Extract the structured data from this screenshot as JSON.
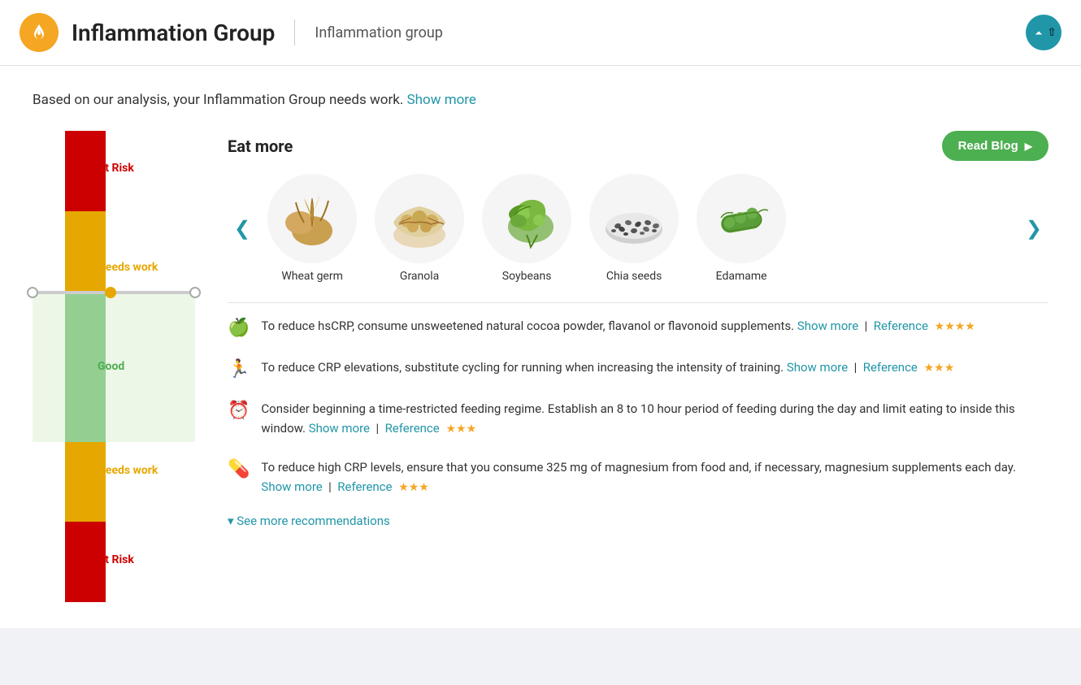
{
  "header": {
    "app_name": "Inflammation Group",
    "subtitle": "Inflammation group",
    "up_button_label": "Up"
  },
  "analysis": {
    "text_before": "Based on our analysis, your Inflammation Group needs work.",
    "show_more_label": "Show more"
  },
  "eat_more": {
    "title": "Eat more",
    "read_blog_label": "Read Blog",
    "foods": [
      {
        "name": "Wheat germ",
        "color": "#c8a870"
      },
      {
        "name": "Granola",
        "color": "#d4a055"
      },
      {
        "name": "Soybeans",
        "color": "#7aab3a"
      },
      {
        "name": "Chia seeds",
        "color": "#888"
      },
      {
        "name": "Edamame",
        "color": "#5a9e3a"
      }
    ]
  },
  "gauge": {
    "segments": [
      {
        "label": "At Risk",
        "class": "at-risk-label",
        "position_pct": 8
      },
      {
        "label": "Needs work",
        "class": "needs-work-label",
        "position_pct": 26
      },
      {
        "label": "Good",
        "class": "good-label",
        "position_pct": 50
      },
      {
        "label": "Needs work",
        "class": "needs-work-label",
        "position_pct": 74
      },
      {
        "label": "At Risk",
        "class": "at-risk-label",
        "position_pct": 91
      }
    ]
  },
  "recommendations": [
    {
      "icon": "🍏",
      "text": "To reduce hsCRP, consume unsweetened natural cocoa powder, flavanol or flavonoid supplements.",
      "show_more_label": "Show more",
      "reference_label": "Reference",
      "stars": 4
    },
    {
      "icon": "🏃",
      "text": "To reduce CRP elevations, substitute cycling for running when increasing the intensity of training.",
      "show_more_label": "Show more",
      "reference_label": "Reference",
      "stars": 3
    },
    {
      "icon": "⏰",
      "text": "Consider beginning a time-restricted feeding regime. Establish an 8 to 10 hour period of feeding during the day and limit eating to inside this window.",
      "show_more_label": "Show more",
      "reference_label": "Reference",
      "stars": 3
    },
    {
      "icon": "💊",
      "text": "To reduce high CRP levels, ensure that you consume 325 mg of magnesium from food and, if necessary, magnesium supplements each day.",
      "show_more_label": "Show more",
      "reference_label": "Reference",
      "stars": 3
    }
  ],
  "see_more": {
    "label": "▾ See more recommendations"
  }
}
